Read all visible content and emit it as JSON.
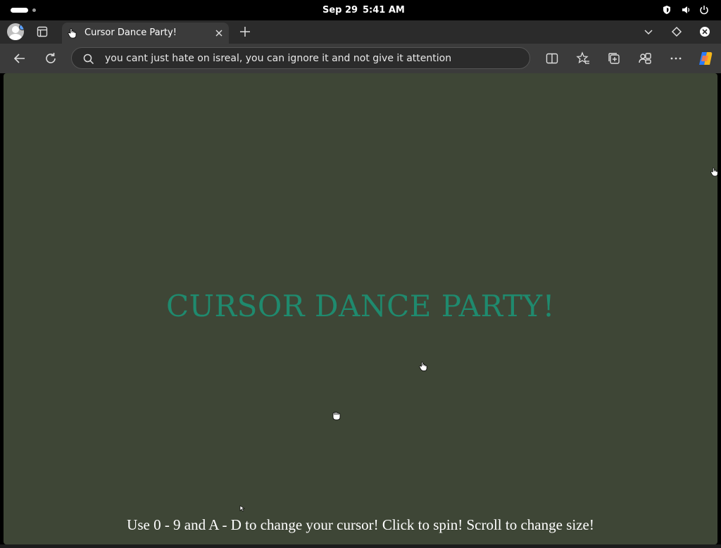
{
  "system": {
    "date": "Sep 29",
    "time": "5:41 AM",
    "icons": [
      "shield-icon",
      "volume-icon",
      "power-icon"
    ]
  },
  "browser": {
    "tab": {
      "title": "Cursor Dance Party!",
      "favicon": "hand-cursor-icon"
    },
    "address_bar": {
      "text": "you cant just hate on isreal, you can ignore it and not give it attention"
    },
    "toolbar_icons": [
      "split-screen-icon",
      "favorites-icon",
      "collections-icon",
      "extensions-icon",
      "more-icon",
      "copilot-icon"
    ]
  },
  "page": {
    "headline": "CURSOR DANCE PARTY!",
    "instructions": "Use 0 - 9 and A - D to change your cursor! Click to spin! Scroll to change size!",
    "headline_color": "#1f8a6e",
    "background_color": "#3e4636"
  }
}
